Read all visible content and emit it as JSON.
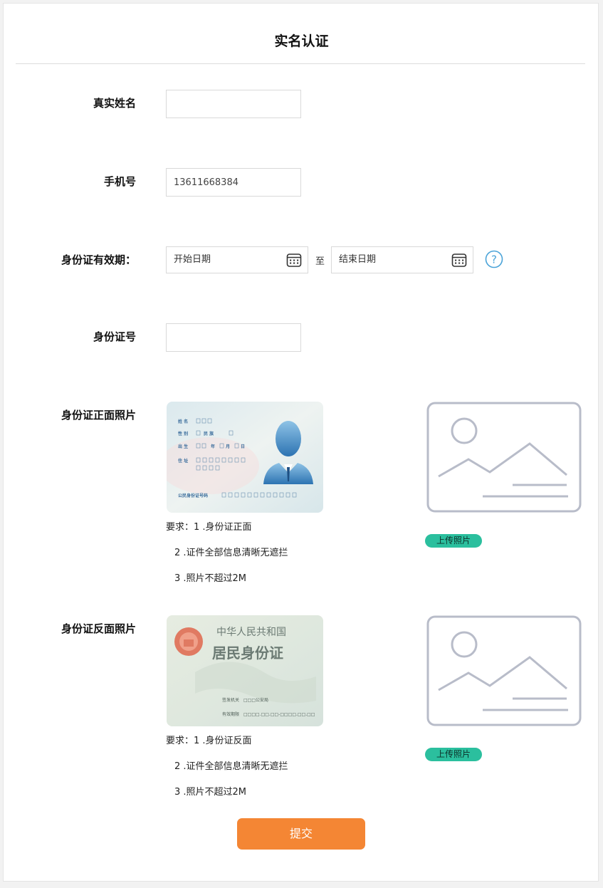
{
  "header": {
    "title": "实名认证"
  },
  "form": {
    "name": {
      "label": "真实姓名",
      "value": ""
    },
    "phone": {
      "label": "手机号",
      "value": "13611668384"
    },
    "validity": {
      "label": "身份证有效期：",
      "start_placeholder": "开始日期",
      "separator": "至",
      "end_placeholder": "结束日期",
      "help": "?"
    },
    "id_number": {
      "label": "身份证号",
      "value": ""
    },
    "front": {
      "label": "身份证正面照片",
      "req1": "要求：1 .身份证正面",
      "req2": "2 .证件全部信息清晰无遮拦",
      "req3": "3 .照片不超过2M",
      "upload": "上传照片",
      "card": {
        "name": "姓 名",
        "sex": "性 别",
        "ethnic": "民 族",
        "birth": "出 生",
        "year": "年",
        "month": "月",
        "day": "日",
        "address": "住 址",
        "id_label": "公民身份证号码"
      }
    },
    "back": {
      "label": "身份证反面照片",
      "req1": "要求：1 .身份证反面",
      "req2": "2 .证件全部信息清晰无遮拦",
      "req3": "3 .照片不超过2M",
      "upload": "上传照片",
      "card": {
        "line1": "中华人民共和国",
        "line2": "居民身份证",
        "issuer": "签发机关",
        "issuer_value": "□□□公安局",
        "validity": "有效期限",
        "validity_value": "□□□□.□□.□□-□□□□.□□.□□"
      }
    },
    "submit": "提交"
  },
  "colors": {
    "accent": "#f48634",
    "upload": "#2bbf9e",
    "help": "#4aa3d8"
  }
}
